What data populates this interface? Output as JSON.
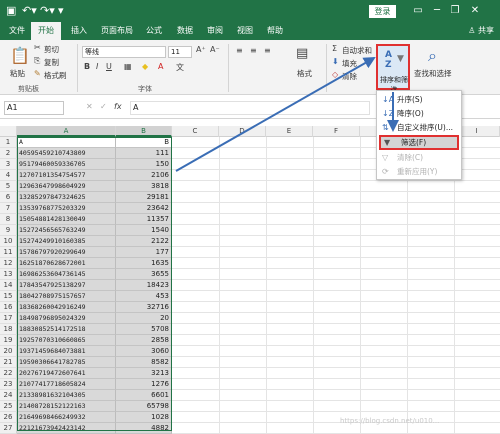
{
  "titlebar": {
    "save_icon": "save-icon",
    "undo_icon": "undo-icon",
    "redo_icon": "redo-icon",
    "login_label": "登录",
    "share_label": "共享"
  },
  "tabs": [
    "文件",
    "开始",
    "插入",
    "页面布局",
    "公式",
    "数据",
    "审阅",
    "视图",
    "帮助"
  ],
  "ribbon": {
    "paste_label": "粘贴",
    "cut_label": "剪切",
    "copy_label": "复制",
    "format_painter_label": "格式刷",
    "clipboard_group": "剪贴板",
    "font_name": "等线",
    "font_size": "11",
    "font_group": "字体",
    "format_label": "格式",
    "autosum_label": "自动求和",
    "fill_label": "填充",
    "clear_label": "清除",
    "sort_filter_label": "排序和筛选",
    "find_select_label": "查找和选择"
  },
  "formula_bar": {
    "name_box": "A1",
    "fx_label": "fx",
    "content": "A"
  },
  "sheet": {
    "columns": [
      "A",
      "B",
      "C",
      "D",
      "E",
      "F",
      "G",
      "H",
      "I"
    ],
    "header_row": {
      "a": "A",
      "b": "B"
    },
    "rows": [
      [
        "1",
        "A",
        "B"
      ],
      [
        "2",
        "40595459210743809",
        "111"
      ],
      [
        "3",
        "95179460059336705",
        "150"
      ],
      [
        "4",
        "12707101354754577",
        "2106"
      ],
      [
        "5",
        "12963647998604929",
        "3818"
      ],
      [
        "6",
        "13285297847324625",
        "29181"
      ],
      [
        "7",
        "13539768775203329",
        "23642"
      ],
      [
        "8",
        "15054881428130049",
        "11357"
      ],
      [
        "9",
        "15272456565763249",
        "1540"
      ],
      [
        "10",
        "15274249910160385",
        "2122"
      ],
      [
        "11",
        "15786797920299649",
        "177"
      ],
      [
        "12",
        "16251870628672001",
        "1635"
      ],
      [
        "13",
        "16986253604736145",
        "3655"
      ],
      [
        "14",
        "17843547925138297",
        "18423"
      ],
      [
        "15",
        "18042708975157657",
        "453"
      ],
      [
        "16",
        "18368260042916249",
        "32716"
      ],
      [
        "17",
        "18498796895024329",
        "20"
      ],
      [
        "18",
        "18830852514172518",
        "5708"
      ],
      [
        "19",
        "19257070310660865",
        "2858"
      ],
      [
        "20",
        "19371459684073881",
        "3060"
      ],
      [
        "21",
        "19590306641782785",
        "8582"
      ],
      [
        "22",
        "20276719472607641",
        "3213"
      ],
      [
        "23",
        "21077417718605824",
        "1276"
      ],
      [
        "24",
        "21338981632104305",
        "6601"
      ],
      [
        "25",
        "21408728152122163",
        "65798"
      ],
      [
        "26",
        "21649698466249932",
        "1028"
      ],
      [
        "27",
        "22121673942423142",
        "4882"
      ]
    ]
  },
  "sort_menu": {
    "asc": "升序(S)",
    "desc": "降序(O)",
    "custom": "自定义排序(U)...",
    "filter": "筛选(F)",
    "clear": "清除(C)",
    "reapply": "重新应用(Y)"
  },
  "colors": {
    "excel_green": "#217346",
    "highlight_red": "#e03030",
    "arrow_blue": "#3a6db5"
  },
  "watermark": "https://blog.csdn.net/u010..."
}
